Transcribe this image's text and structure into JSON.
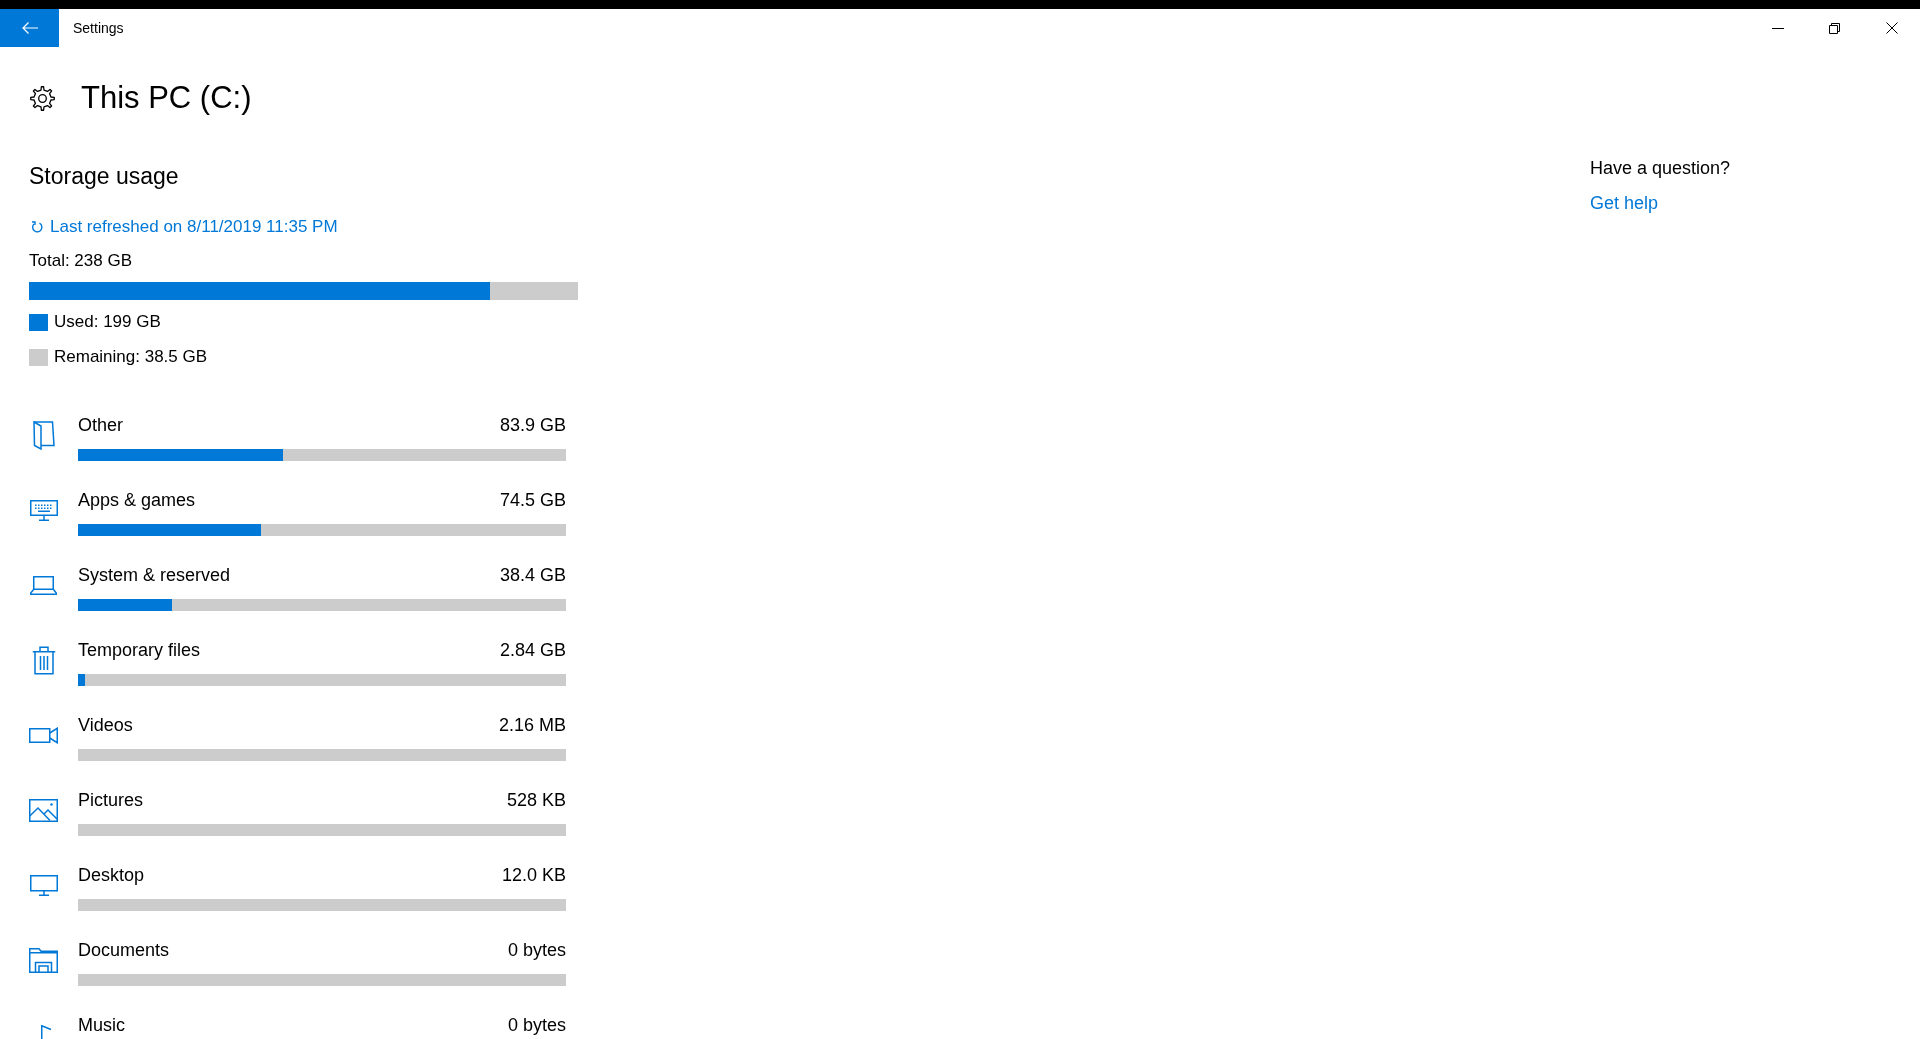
{
  "window": {
    "title": "Settings"
  },
  "page": {
    "title": "This PC (C:)"
  },
  "storage_usage": {
    "heading": "Storage usage",
    "refresh_link": "Last refreshed on 8/11/2019 11:35 PM",
    "total": "Total: 238 GB",
    "level": 0.84,
    "legend": [
      {
        "label": "Used: 199 GB",
        "color": "#0078d7"
      },
      {
        "label": "Remaining: 38.5 GB",
        "color": "#cccccc"
      }
    ]
  },
  "categories": [
    {
      "name": "Other",
      "size": "83.9 GB",
      "level": 0.42
    },
    {
      "name": "Apps & games",
      "size": "74.5 GB",
      "level": 0.374
    },
    {
      "name": "System & reserved",
      "size": "38.4 GB",
      "level": 0.193
    },
    {
      "name": "Temporary files",
      "size": "2.84 GB",
      "level": 0.014
    },
    {
      "name": "Videos",
      "size": "2.16 MB",
      "level": 0
    },
    {
      "name": "Pictures",
      "size": "528 KB",
      "level": 0
    },
    {
      "name": "Desktop",
      "size": "12.0 KB",
      "level": 0
    },
    {
      "name": "Documents",
      "size": "0 bytes",
      "level": 0
    },
    {
      "name": "Music",
      "size": "0 bytes"
    }
  ],
  "help": {
    "question": "Have a question?",
    "link": "Get help"
  }
}
